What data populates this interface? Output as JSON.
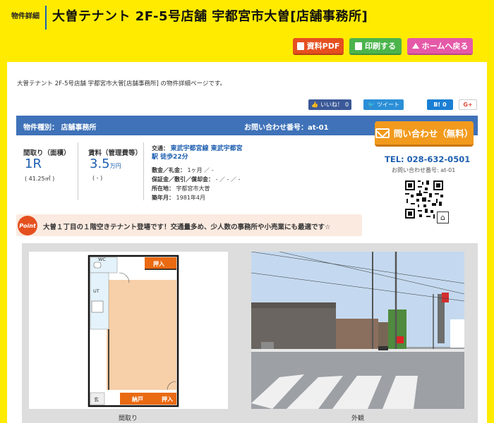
{
  "header": {
    "label": "物件詳細",
    "title": "大曽テナント 2F-5号店舗 宇都宮市大曽[店舗事務所]"
  },
  "toolbar": {
    "pdf_label": "資料PDF",
    "print_label": "印刷する",
    "home_label": "ホームへ戻る"
  },
  "description": "大曽テナント 2F-5号店舗 宇都宮市大曽[店舗事務所] の物件詳細ページです。",
  "social": {
    "like_label": "いいね！",
    "like_count": "0",
    "tweet_label": "ツイート",
    "hatena_label": "B!",
    "hatena_count": "0",
    "gplus_label": "G+"
  },
  "property": {
    "type_text": "物件種別： 店舗事務所",
    "inquiry_number_text": "お問い合わせ番号：at-01",
    "layout_label": "間取り（面積）",
    "layout_value": "1R",
    "area": "( 41.25㎡ )",
    "rent_label": "賃料（管理費等）",
    "rent_value": "3.5",
    "rent_unit": "万円",
    "rent_fee": "( - )",
    "details": {
      "traffic_label": "交通：",
      "traffic_value_line1": "東武宇都宮線 東武宇都宮",
      "traffic_value_line2": "駅 徒歩22分",
      "deposit_label": "敷金／礼金：",
      "deposit_value": "1ヶ月 ／ -",
      "guarantee_label": "保証金／敷引／償却金：",
      "guarantee_value": "- ／ - ／ -",
      "address_label": "所在地：",
      "address_value": "宇都宮市大曽",
      "built_label": "築年月：",
      "built_value": "1981年4月"
    }
  },
  "contact": {
    "button_label": "問い合わせ（無料）",
    "tel": "TEL: 028-632-0501",
    "inquiry_number": "お問い合わせ番号: at-01"
  },
  "point": {
    "badge": "Point",
    "text": "大曽１丁目の１階空きテナント登場です！交通量多め、少人数の事務所や小売業にも最適です☆"
  },
  "gallery": {
    "floorplan_caption": "間取り",
    "exterior_caption": "外観",
    "floorplan_labels": {
      "wc": "WC",
      "ut": "UT",
      "oshiire_top": "押入",
      "oshiire_bottom": "押入",
      "nando": "納戸",
      "entrance": "玄"
    }
  },
  "colors": {
    "page_bg": "#ffeb00",
    "accent_blue": "#3f72b8",
    "pdf_button": "#e5501f",
    "print_button": "#4cb44c",
    "home_button": "#e55aa8",
    "inquiry_button": "#f29a1d"
  }
}
